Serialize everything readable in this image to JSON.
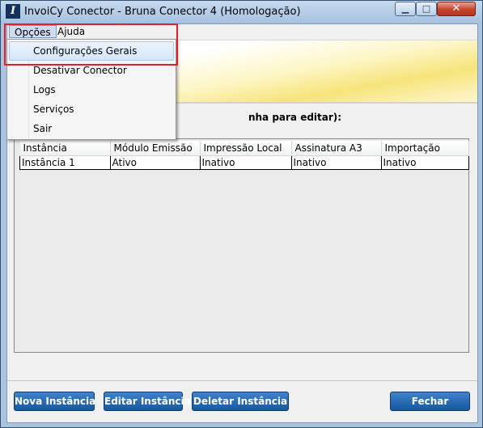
{
  "window": {
    "title": "InvoiCy Conector - Bruna Conector 4 (Homologação)",
    "app_icon_glyph": "I",
    "minimize_glyph": "▁",
    "maximize_glyph": "□",
    "close_glyph": "✕"
  },
  "menubar": {
    "items": [
      "Opções",
      "Ajuda"
    ]
  },
  "dropdown": {
    "items": [
      "Configurações Gerais",
      "Desativar Conector",
      "Logs",
      "Serviços",
      "Sair"
    ],
    "highlighted_index": 0
  },
  "main": {
    "instruction": "nha para editar):"
  },
  "grid": {
    "columns": [
      "Instância",
      "Módulo Emissão",
      "Impressão Local",
      "Assinatura A3",
      "Importação"
    ],
    "rows": [
      [
        "Instância 1",
        "Ativo",
        "Inativo",
        "Inativo",
        "Inativo"
      ]
    ]
  },
  "buttons": {
    "nova": "Nova Instância",
    "editar": "Editar Instância",
    "deletar": "Deletar Instância",
    "fechar": "Fechar"
  },
  "colors": {
    "button_blue": "#1f63ab",
    "highlight_box": "#e0202a",
    "banner_yellow": "#f6e47b"
  }
}
